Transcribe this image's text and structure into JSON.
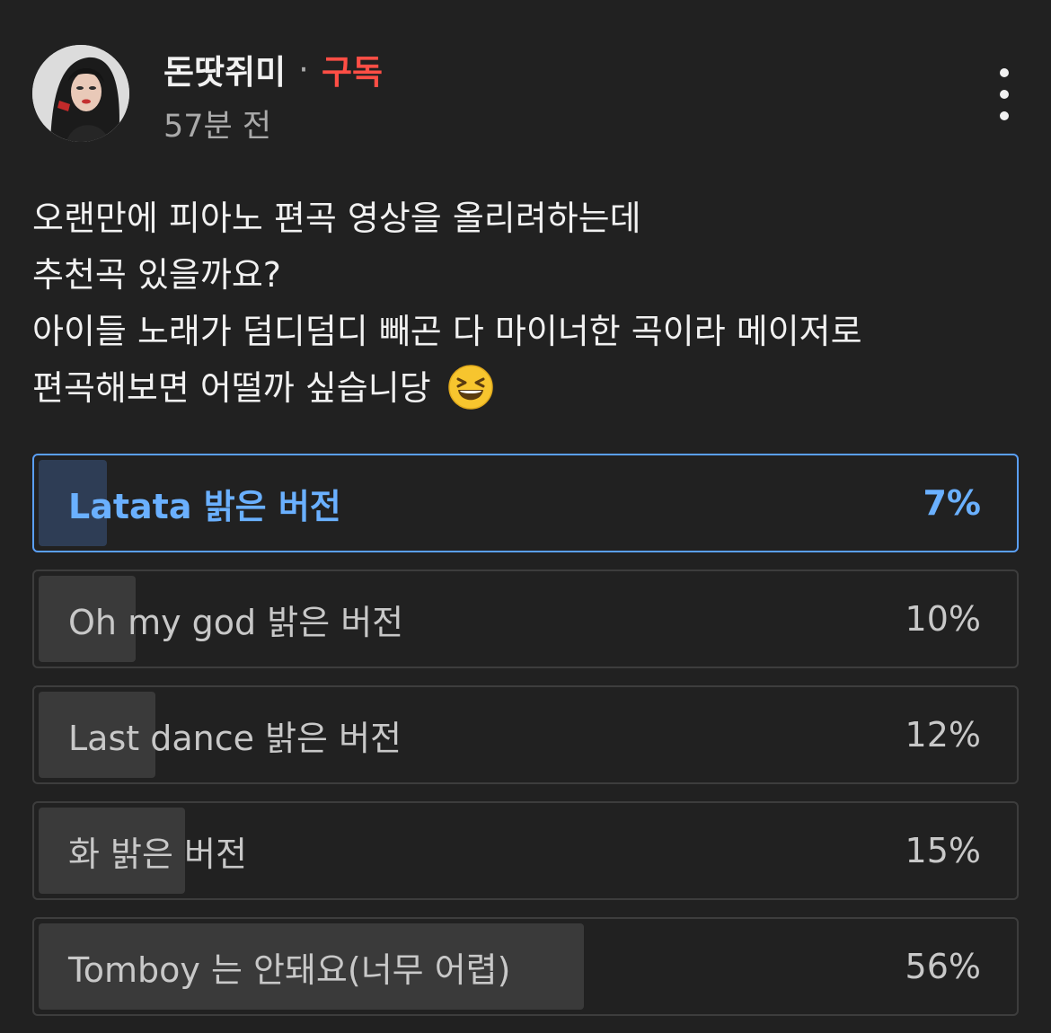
{
  "header": {
    "channel_name": "돈땃쥐미",
    "separator": "·",
    "subscribe_label": "구독",
    "timestamp": "57분 전",
    "avatar_icon": "avatar-photo",
    "menu_icon": "more-vert-icon"
  },
  "post": {
    "lines": [
      "오랜만에 피아노 편곡 영상을 올리려하는데",
      "추천곡 있을까요?",
      "아이들 노래가 덤디덤디 빼곤 다 마이너한 곡이라 메이저로",
      "편곡해보면 어떨까 싶습니당"
    ],
    "emoji": "grinning-squinting-face"
  },
  "poll": {
    "options": [
      {
        "label": "Latata 밝은 버전",
        "percent_label": "7%",
        "percent": 7,
        "selected": true
      },
      {
        "label": "Oh my god 밝은 버전",
        "percent_label": "10%",
        "percent": 10,
        "selected": false
      },
      {
        "label": "Last dance 밝은 버전",
        "percent_label": "12%",
        "percent": 12,
        "selected": false
      },
      {
        "label": "화 밝은 버전",
        "percent_label": "15%",
        "percent": 15,
        "selected": false
      },
      {
        "label": "Tomboy 는 안돼요(너무 어렵)",
        "percent_label": "56%",
        "percent": 56,
        "selected": false
      }
    ]
  },
  "colors": {
    "background": "#212121",
    "subscribe": "#ff4e45",
    "selected_accent": "#5a9ff7"
  }
}
